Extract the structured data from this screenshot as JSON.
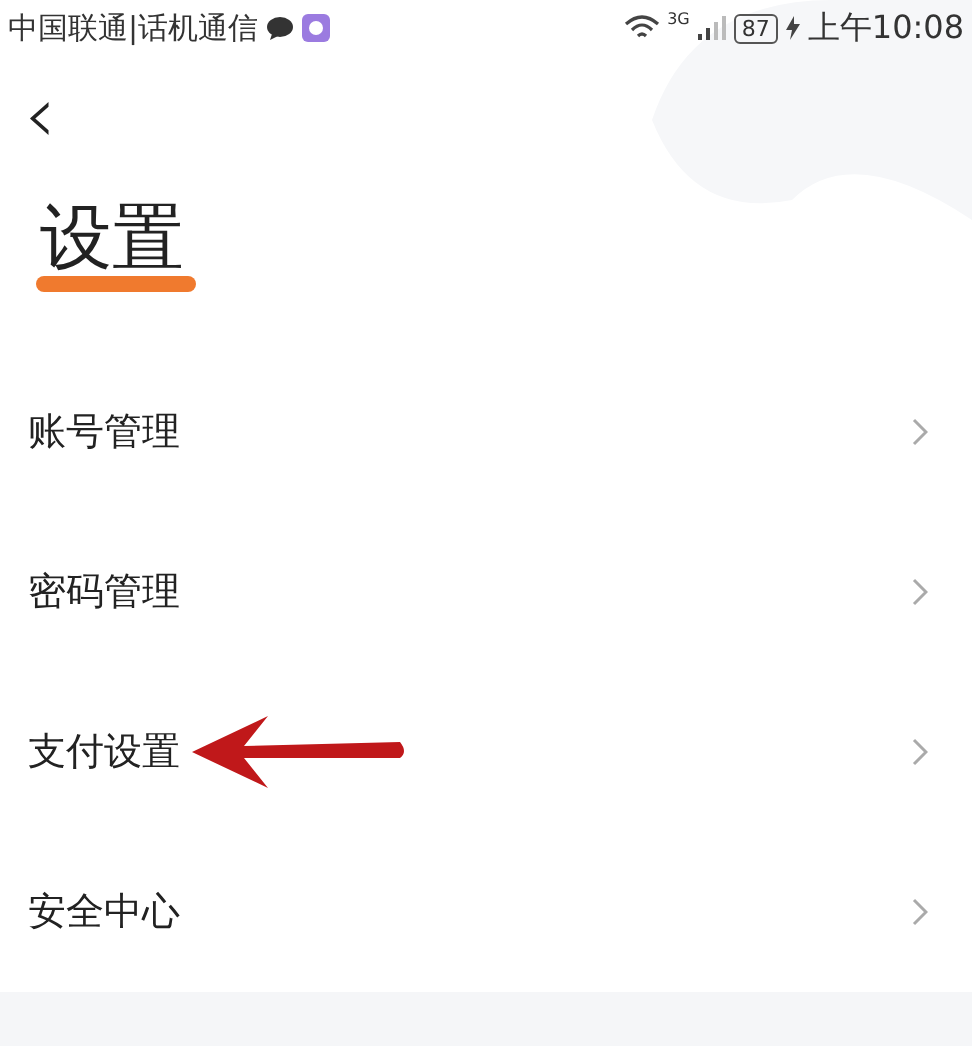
{
  "status_bar": {
    "carrier": "中国联通|话机通信",
    "network": "3G",
    "battery": "87",
    "time": "上午10:08"
  },
  "header": {
    "back": "‹",
    "title": "设置"
  },
  "menu": [
    {
      "label": "账号管理",
      "highlighted": false
    },
    {
      "label": "密码管理",
      "highlighted": false
    },
    {
      "label": "支付设置",
      "highlighted": true
    },
    {
      "label": "安全中心",
      "highlighted": false
    }
  ]
}
